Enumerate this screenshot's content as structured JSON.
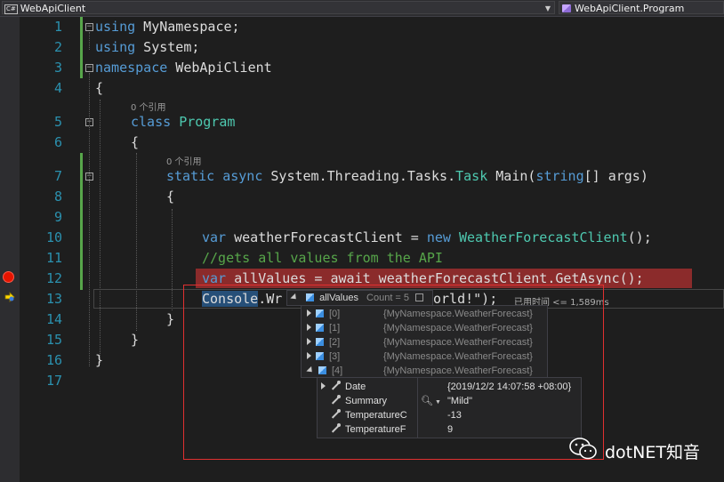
{
  "nav": {
    "left_icon": "C#",
    "left_label": "WebApiClient",
    "right_label": "WebApiClient.Program"
  },
  "line_numbers": [
    "1",
    "2",
    "3",
    "4",
    "5",
    "6",
    "7",
    "8",
    "9",
    "10",
    "11",
    "12",
    "13",
    "14",
    "15",
    "16",
    "17"
  ],
  "codelens": {
    "class_refs": "0 个引用",
    "method_refs": "0 个引用"
  },
  "code": {
    "l1_kw": "using",
    "l1_ns": " MyNamespace;",
    "l2_kw": "using",
    "l2_ns": " System;",
    "l3_kw": "namespace",
    "l3_ns": " WebApiClient",
    "l4": "{",
    "l5_kw": "class",
    "l5_ty": "Program",
    "l6": "{",
    "l7_kw1": "static",
    "l7_kw2": "async",
    "l7_mid": " System.Threading.Tasks.",
    "l7_ty": "Task",
    "l7_name": " Main(",
    "l7_kw3": "string",
    "l7_rest": "[] args)",
    "l8": "{",
    "l10_kw": "var",
    "l10_var": " weatherForecastClient = ",
    "l10_kw2": "new",
    "l10_ty": " WeatherForecastClient",
    "l10_end": "();",
    "l11": "//gets all values from the API",
    "l12_kw": "var",
    "l12_rest": " allValues = await weatherForecastClient.GetAsync();",
    "l13_sel": "Console",
    "l13_rest": ".Wr",
    "l13_tail": "orld!\");",
    "l14": "}",
    "l15": "}",
    "l16": "}"
  },
  "elapsed": "已用时间 <= 1,589ms",
  "datatip": {
    "name": "allValues",
    "count": "Count = 5",
    "items": [
      {
        "index": "[0]",
        "value": "{MyNamespace.WeatherForecast}"
      },
      {
        "index": "[1]",
        "value": "{MyNamespace.WeatherForecast}"
      },
      {
        "index": "[2]",
        "value": "{MyNamespace.WeatherForecast}"
      },
      {
        "index": "[3]",
        "value": "{MyNamespace.WeatherForecast}"
      },
      {
        "index": "[4]",
        "value": "{MyNamespace.WeatherForecast}"
      }
    ]
  },
  "properties": [
    {
      "name": "Date",
      "value": "{2019/12/2 14:07:58 +08:00}"
    },
    {
      "name": "Summary",
      "value": "\"Mild\""
    },
    {
      "name": "TemperatureC",
      "value": "-13"
    },
    {
      "name": "TemperatureF",
      "value": "9"
    }
  ],
  "watermark": "dotNET知音",
  "colors": {
    "keyword": "#569cd6",
    "type": "#4ec9b0",
    "comment": "#57a64a",
    "line_number": "#2b91af",
    "breakpoint": "#e51400",
    "annotation": "#e03030"
  }
}
